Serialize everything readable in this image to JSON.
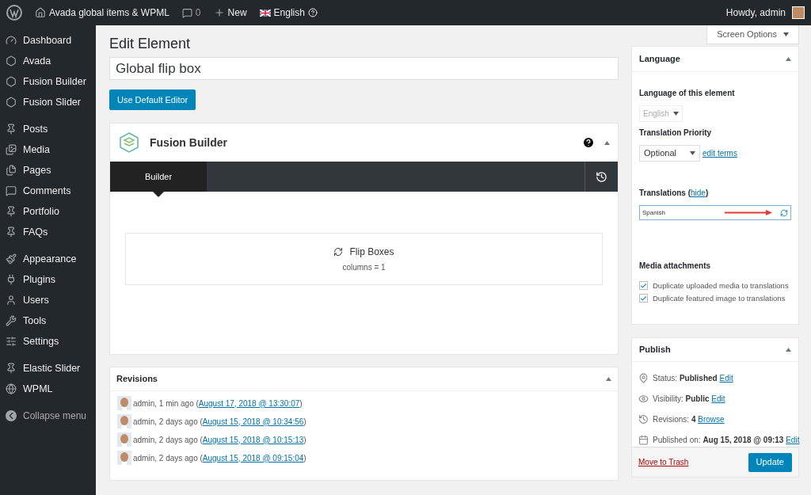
{
  "admin_bar": {
    "site": "Avada global items & WPML",
    "comments": "0",
    "new": "New",
    "language": "English",
    "greeting": "Howdy, admin"
  },
  "sidebar": {
    "groups": [
      {
        "items": [
          "Dashboard",
          "Avada",
          "Fusion Builder",
          "Fusion Slider"
        ]
      },
      {
        "items": [
          "Posts",
          "Media",
          "Pages",
          "Comments",
          "Portfolio",
          "FAQs"
        ]
      },
      {
        "items": [
          "Appearance",
          "Plugins",
          "Users",
          "Tools",
          "Settings"
        ]
      },
      {
        "items": [
          "Elastic Slider",
          "WPML"
        ]
      }
    ],
    "collapse": "Collapse menu"
  },
  "screen_options": "Screen Options",
  "page_title": "Edit Element",
  "title_field": {
    "value": "Global flip box"
  },
  "default_editor_button": "Use Default Editor",
  "fusion_builder": {
    "title": "Fusion Builder",
    "tabs": [
      {
        "label": "Builder",
        "selected": true
      }
    ],
    "element": {
      "title": "Flip Boxes",
      "params": "columns = 1"
    }
  },
  "revisions": {
    "title": "Revisions",
    "items": [
      {
        "prefix": "admin, 1 min ago (",
        "date": "August 17, 2018 @ 13:30:07",
        "suffix": ")"
      },
      {
        "prefix": "admin, 2 days ago (",
        "date": "August 15, 2018 @ 10:34:56",
        "suffix": ")"
      },
      {
        "prefix": "admin, 2 days ago (",
        "date": "August 15, 2018 @ 10:15:13",
        "suffix": ")"
      },
      {
        "prefix": "admin, 2 days ago (",
        "date": "August 15, 2018 @ 09:15:04",
        "suffix": ")"
      }
    ]
  },
  "language_box": {
    "title": "Language",
    "language_label": "Language of this element",
    "language_value": "English",
    "priority_label": "Translation Priority",
    "priority_value": "Optional",
    "edit_terms": "edit terms",
    "translations_label": "Translations (",
    "translations_hide": "hide",
    "translations_suffix": ")",
    "translation": "Spanish",
    "media_label": "Media attachments",
    "options": [
      {
        "label": "Duplicate uploaded media to translations",
        "checked": true
      },
      {
        "label": "Duplicate featured image to translations",
        "checked": true
      }
    ]
  },
  "publish": {
    "title": "Publish",
    "rows": [
      {
        "label": "Status: ",
        "value": "Published",
        "link": "Edit"
      },
      {
        "label": "Visibility: ",
        "value": "Public",
        "link": "Edit"
      },
      {
        "label": "Revisions: ",
        "value": "4",
        "link": "Browse"
      },
      {
        "label": "Published on: ",
        "value": "Aug 15, 2018 @ 09:13",
        "link": "Edit"
      }
    ],
    "trash": "Move to Trash",
    "update": "Update"
  }
}
